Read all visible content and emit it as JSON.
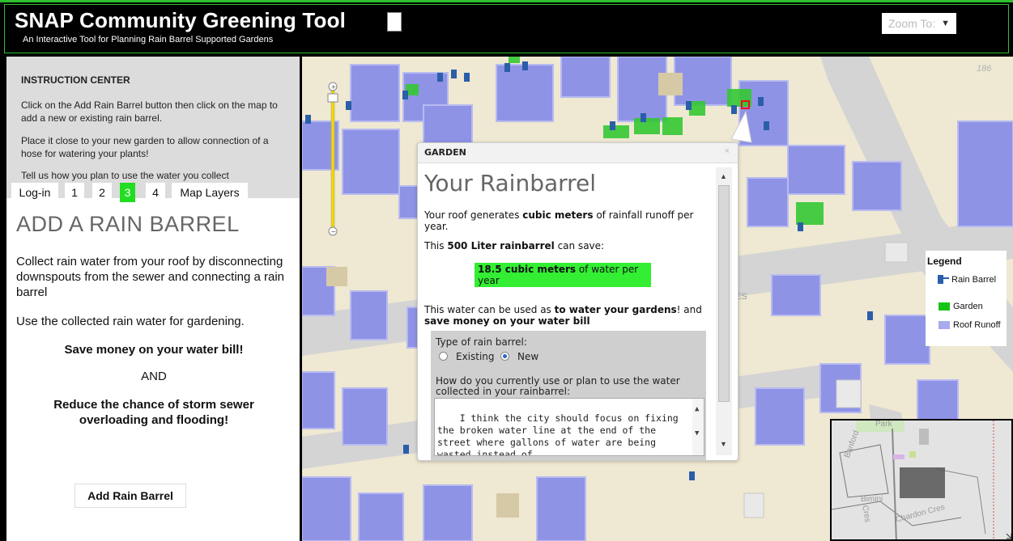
{
  "header": {
    "title": "SNAP Community Greening Tool",
    "subtitle": "An Interactive Tool for Planning Rain Barrel Supported Gardens",
    "zoom_placeholder": "Zoom To:"
  },
  "instructions": {
    "title": "INSTRUCTION CENTER",
    "p1": "Click on the Add Rain Barrel button then click on the map to add a new or existing rain barrel.",
    "p2": "Place it close to your new garden to allow connection of a hose for watering your plants!",
    "p3": "Tell us how you plan to use the water you collect"
  },
  "tabs": [
    "Log-in",
    "1",
    "2",
    "3",
    "4",
    "Map Layers"
  ],
  "active_tab": "3",
  "left_panel": {
    "heading": "ADD A RAIN BARREL",
    "p1": "Collect rain water from your roof by disconnecting downspouts from the sewer and connecting a rain barrel",
    "p2": "Use the collected rain water for gardening.",
    "p3": "Save money on your water bill!",
    "p4": "AND",
    "p5": "Reduce the chance of storm sewer overloading and flooding!",
    "button": "Add Rain Barrel"
  },
  "popup": {
    "header": "GARDEN",
    "close": "×",
    "title": "Your Rainbarrel",
    "line1_a": "Your roof generates ",
    "line1_b": "cubic meters",
    "line1_c": " of rainfall runoff per year.",
    "line2_a": "This ",
    "line2_b": "500 Liter rainbarrel",
    "line2_c": " can save:",
    "savings_bold": "18.5 cubic meters",
    "savings_rest": " of water per year",
    "line3_a": "This water can be used as ",
    "line3_b": "to water your gardens",
    "line3_c": "! and ",
    "line3_d": "save money on your water bill",
    "type_label": "Type of rain barrel:",
    "options": [
      "Existing",
      "New"
    ],
    "selected_option": "New",
    "question": "How do you currently use or plan to use the water collected in your rainbarrel:",
    "answer": "I think the city should focus on fixing the broken water line at the end of the street where gallons of water are being wasted instead of"
  },
  "legend": {
    "title": "Legend",
    "items": [
      {
        "label": "Rain Barrel",
        "icon": "rain-barrel-icon"
      },
      {
        "label": "Garden",
        "color": "#17c417"
      },
      {
        "label": "Roof Runoff",
        "color": "#a9a9ee"
      }
    ]
  },
  "map_labels": {
    "street_number": "186",
    "street_fragment": "ES",
    "overview": [
      "Park",
      "Banford",
      "Bimini",
      "Cres",
      "Chardon Cres"
    ]
  },
  "colors": {
    "accent_green": "#22dd22",
    "roof": "#8f93e6",
    "garden": "#34c834",
    "map_bg": "#efe8d2"
  }
}
